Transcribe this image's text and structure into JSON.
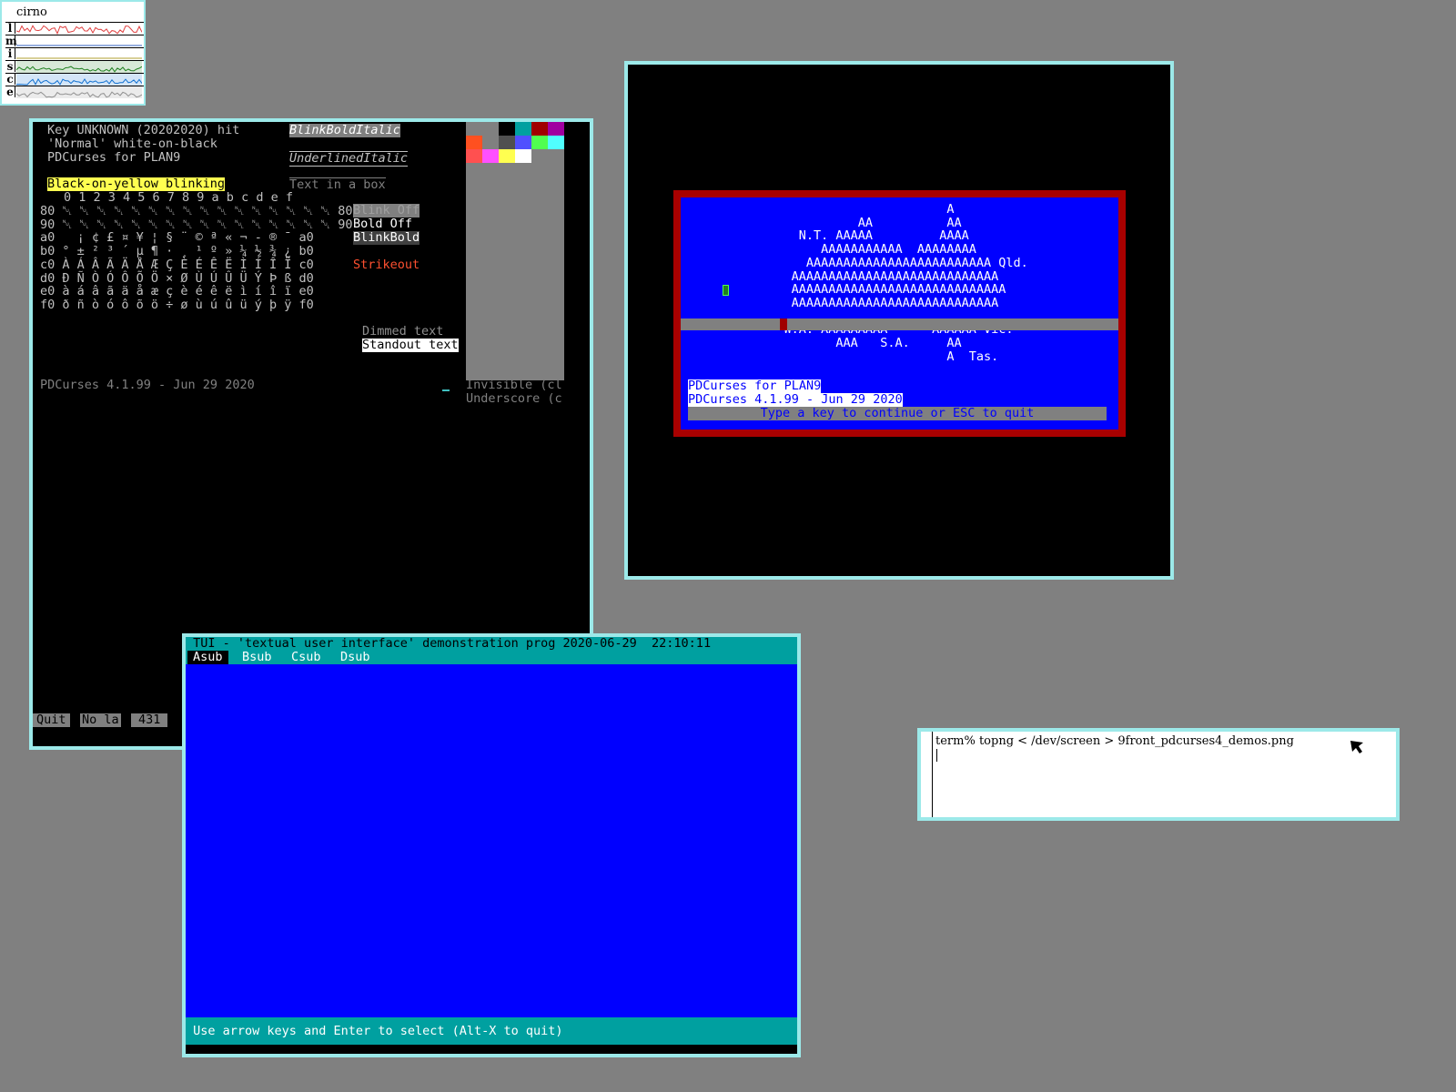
{
  "stats": {
    "title": "cirno",
    "rows": [
      {
        "label": "l",
        "color": "#e04040"
      },
      {
        "label": "m",
        "color": "#3060c0"
      },
      {
        "label": "i",
        "color": "#b0a030"
      },
      {
        "label": "s",
        "color": "#208020"
      },
      {
        "label": "c",
        "color": "#1070d0"
      },
      {
        "label": "e",
        "color": "#909090"
      }
    ]
  },
  "testcurs": {
    "key_hit": "Key UNKNOWN (20202020) hit",
    "normal": "'Normal' white-on-black",
    "pdcurses_plan9": "PDCurses for PLAN9",
    "blink_yellow": "Black-on-yellow blinking",
    "blink_bold_italic": "BlinkBoldItalic",
    "underlined_italic": "UnderlinedItalic",
    "text_in_box": "Text in a box",
    "hex_header": "0 1 2 3 4 5 6 7 8 9 a b c d e f",
    "char_rows": [
      "80 ␀ ␀ ␀ ␀ ␀ ␀ ␀ ␀ ␀ ␀ ␀ ␀ ␀ ␀ ␀ ␀ 80",
      "90 ␀ ␀ ␀ ␀ ␀ ␀ ␀ ␀ ␀ ␀ ␀ ␀ ␀ ␀ ␀ ␀ 90",
      "a0   ¡ ¢ £ ¤ ¥ ¦ § ¨ © ª « ¬ - ® ¯ a0",
      "b0 ° ± ² ³ ´ µ ¶ · ¸ ¹ º » ¼ ½ ¾ ¿ b0",
      "c0 À Á Â Ã Ä Å Æ Ç È É Ê Ë Ì Í Î Ï c0",
      "d0 Ð Ñ Ò Ó Ô Õ Ö × Ø Ù Ú Û Ü Ý Þ ß d0",
      "e0 à á â ã ä å æ ç è é ê ë ì í î ï e0",
      "f0 ð ñ ò ó ô õ ö ÷ ø ù ú û ü ý þ ÿ f0"
    ],
    "blink_off": "Blink Off",
    "bold_off": "Bold Off",
    "blink_bold": "BlinkBold",
    "strikeout": "Strikeout",
    "dimmed": "Dimmed text",
    "standout": "Standout text",
    "invisible": "Invisible (cl",
    "underscore": "Underscore (c",
    "version": "PDCurses 4.1.99 - Jun 29 2020",
    "status_quit": "Quit",
    "status_nola": "No la",
    "status_num": "431",
    "palette": [
      "#808080",
      "#808080",
      "#000000",
      "#00a0a0",
      "#a00000",
      "#a000a0",
      "#ff5020",
      "#808080",
      "#505050",
      "#5050ff",
      "#50ff50",
      "#50ffff",
      "#ff5050",
      "#ff50ff",
      "#ffff50",
      "#ffffff",
      "#808080",
      "#808080"
    ]
  },
  "map": {
    "lines": [
      {
        "l": 0,
        "t": "                                  A"
      },
      {
        "l": 1,
        "t": "                      AA          AA"
      },
      {
        "l": 2,
        "t": "              N.T. AAAAA         AAAA"
      },
      {
        "l": 3,
        "t": "                 AAAAAAAAAAA  AAAAAAAA"
      },
      {
        "l": 4,
        "t": "               AAAAAAAAAAAAAAAAAAAAAAAAA Qld."
      },
      {
        "l": 5,
        "t": "             AAAAAAAAAAAAAAAAAAAAAAAAAAAA"
      },
      {
        "l": 6,
        "t": "             AAAAAAAAAAAAAAAAAAAAAAAAAAAAA"
      },
      {
        "l": 7,
        "t": "             AAAAAAAAAAAAAAAAAAAAAAAAAAAA"
      },
      {
        "l": 9,
        "t": "            W.A. AAAAAAAAA      AAAAAA Vic."
      },
      {
        "l": 10,
        "t": "                   AAA   S.A.     AA"
      },
      {
        "l": 11,
        "t": "                                  A  Tas."
      }
    ],
    "plan9": "PDCurses for PLAN9",
    "version": "PDCurses 4.1.99 - Jun 29 2020",
    "prompt": "Type a key to continue or ESC to quit"
  },
  "tui": {
    "title": " TUI - 'textual user interface' demonstration prog 2020-06-29  22:10:11",
    "menu": [
      "Asub",
      "Bsub",
      "Csub",
      "Dsub"
    ],
    "status": " Use arrow keys and Enter to select (Alt-X to quit)"
  },
  "terminal": {
    "command": "term% topng < /dev/screen > 9front_pdcurses4_demos.png"
  }
}
